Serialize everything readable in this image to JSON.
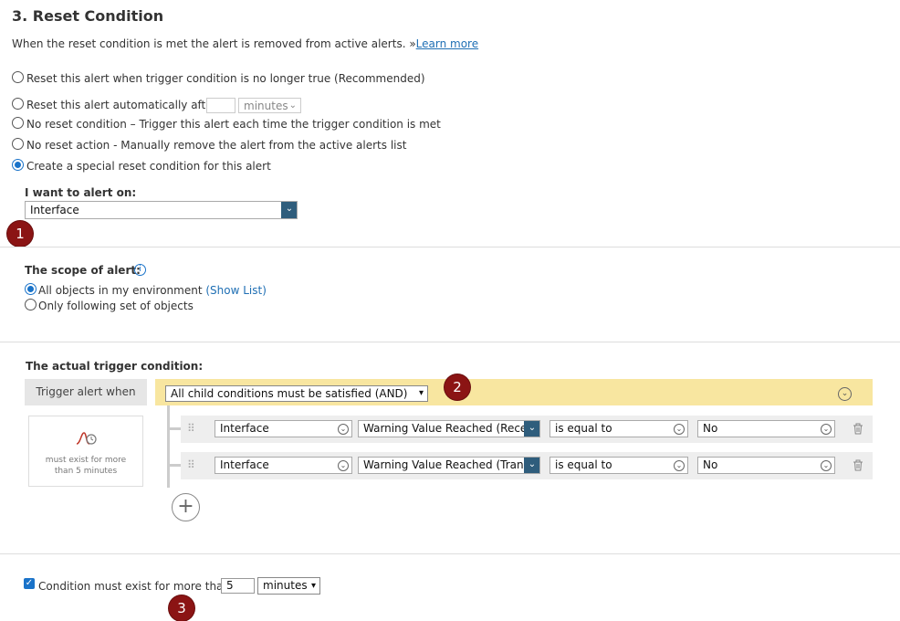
{
  "section_title": "3. Reset Condition",
  "description": "When the reset condition is met the alert is removed from active alerts. »",
  "learn_more": "Learn more",
  "reset_options": {
    "opt1": "Reset this alert when trigger condition is no longer true (Recommended)",
    "opt2": "Reset this alert automatically after",
    "opt2_unit": "minutes",
    "opt3": "No reset condition – Trigger this alert each time the trigger condition is met",
    "opt4": "No reset action - Manually remove the alert from the active alerts list",
    "opt5": "Create a special reset condition for this alert"
  },
  "alert_on": {
    "label": "I want to alert on:",
    "value": "Interface"
  },
  "scope": {
    "label": "The scope of alert:",
    "all_objects": "All objects in my environment",
    "show_list": "(Show List)",
    "following": "Only following set of objects"
  },
  "trigger": {
    "label": "The actual trigger condition:",
    "trigger_when": "Trigger alert when",
    "logic": "All child conditions must be satisfied (AND)",
    "widget_text": "must exist for more than 5 minutes",
    "rows": [
      {
        "object": "Interface",
        "field": "Warning Value Reached (Receive",
        "operator": "is equal to",
        "value": "No"
      },
      {
        "object": "Interface",
        "field": "Warning Value Reached (Transm",
        "operator": "is equal to",
        "value": "No"
      }
    ]
  },
  "condition_exist": {
    "label": "Condition must exist for more than",
    "value": "5",
    "unit": "minutes"
  },
  "badges": {
    "b1": "1",
    "b2": "2",
    "b3": "3"
  },
  "colors": {
    "accent": "#1a73c9",
    "badge": "#8b1414",
    "highlight": "#f8e6a0",
    "navy": "#2f5d7c"
  }
}
